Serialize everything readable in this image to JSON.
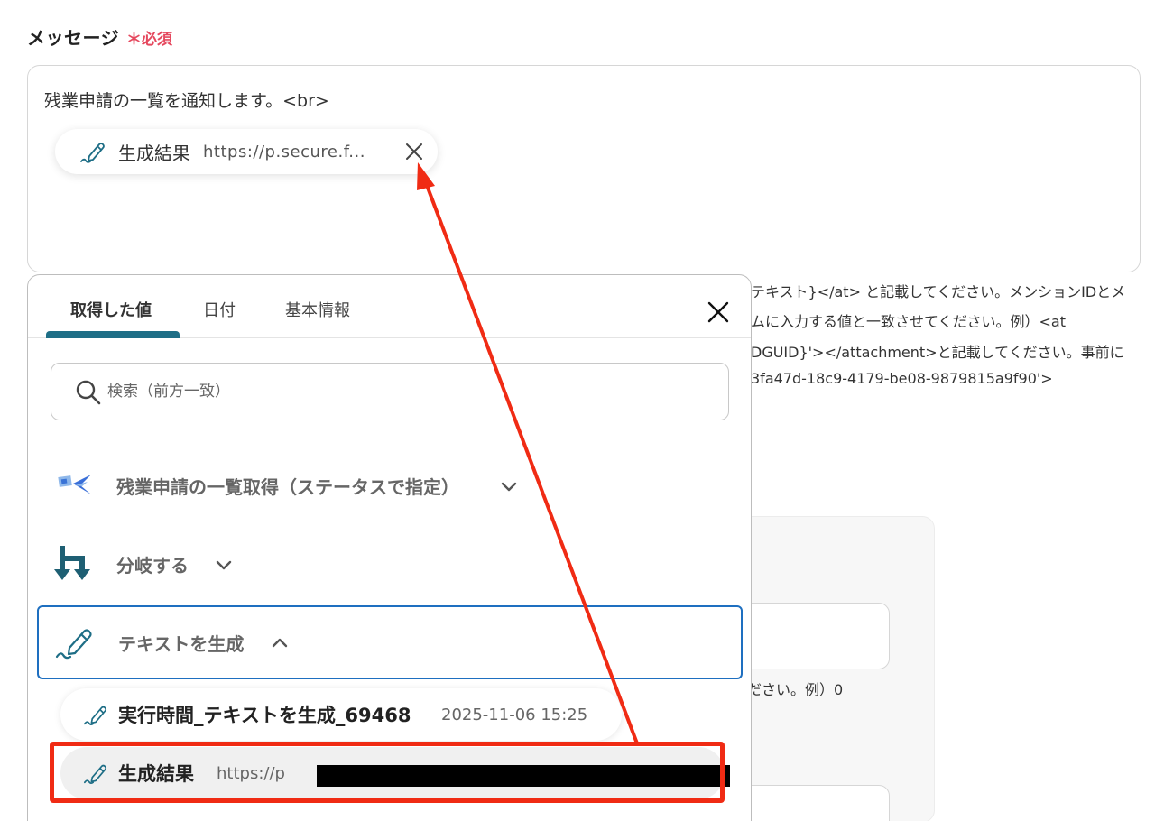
{
  "field": {
    "label": "メッセージ",
    "required": "＊必須"
  },
  "message": {
    "text": "残業申請の一覧を通知します。<br>",
    "chip": {
      "icon": "pen-icon",
      "label": "生成結果",
      "value": "https://p.secure.f..."
    }
  },
  "help": {
    "lines": [
      "テキスト}</at> と記載してください。メンションIDとメ",
      "ムに入力する値と一致させてください。例）<at",
      "DGUID}'></attachment>と記載してください。事前に",
      "3fa47d-18c9-4179-be08-9879815a9f90'>"
    ],
    "hint2": "ださい。例）0"
  },
  "dropdown": {
    "tabs": [
      "取得した値",
      "日付",
      "基本情報"
    ],
    "active_tab": 0,
    "search_placeholder": "検索（前方一致）",
    "sections": [
      {
        "label": "残業申請の一覧取得（ステータスで指定）",
        "icon": "app-logo-icon",
        "expanded": false
      },
      {
        "label": "分岐する",
        "icon": "branch-icon",
        "expanded": false
      },
      {
        "label": "テキストを生成",
        "icon": "pen-icon",
        "expanded": true
      }
    ],
    "items": [
      {
        "label": "実行時間_テキストを生成_69468",
        "value": "2025-11-06 15:25"
      },
      {
        "label": "生成結果",
        "value": "https://p"
      }
    ]
  },
  "colors": {
    "accent": "#1e6e86",
    "required": "#e5485e",
    "selection": "#1e6fc0",
    "annotation": "#f02b14"
  }
}
